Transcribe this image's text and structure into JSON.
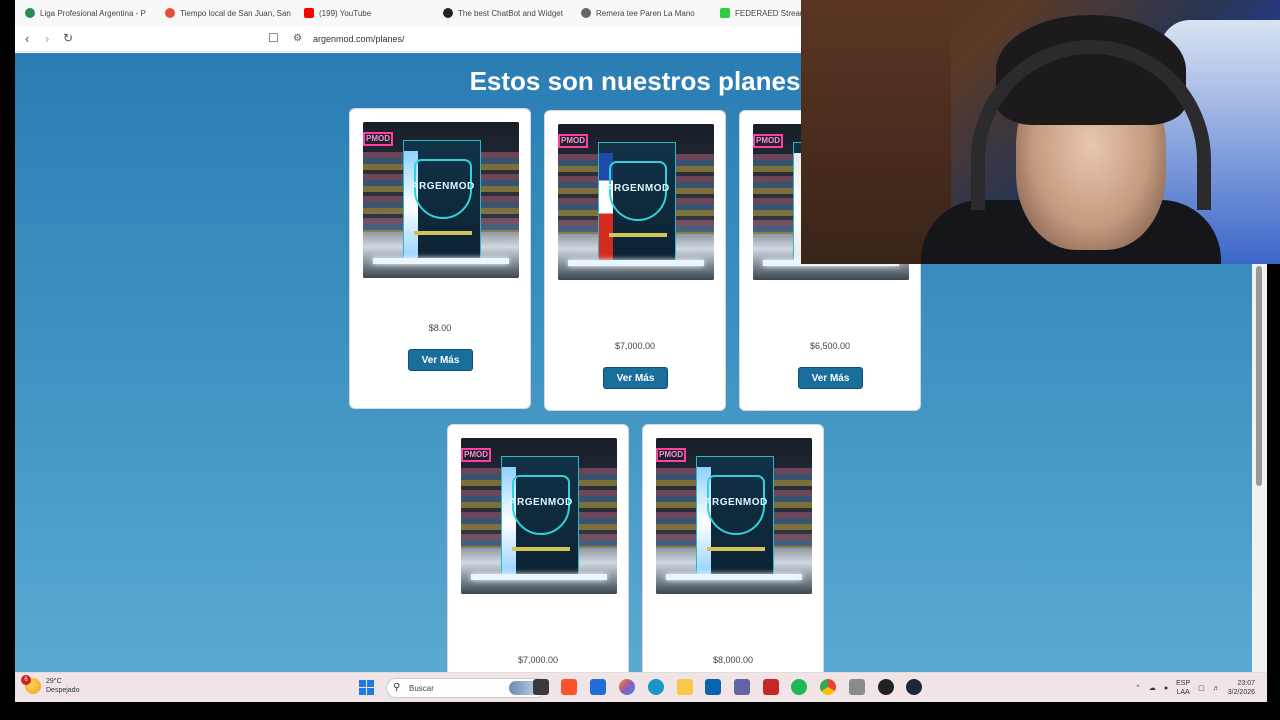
{
  "bookmarks": [
    {
      "label": "Liga Profesional Argentina - P",
      "color": "#2e8b57"
    },
    {
      "label": "Tiempo local de San Juan, San",
      "color": "#e84c3d"
    },
    {
      "label": "(199) YouTube",
      "color": "#ff0000"
    },
    {
      "label": "The best ChatBot and Widget",
      "color": "#222222"
    },
    {
      "label": "Remera tee Paren La Mano",
      "color": "#666666"
    },
    {
      "label": "FEDERAED Stream",
      "color": "#2ecc40"
    }
  ],
  "browser": {
    "url": "argenmod.com/planes/",
    "back_icon": "arrow-left-icon",
    "forward_icon": "arrow-right-icon",
    "reload_icon": "reload-icon"
  },
  "page": {
    "title": "Estos son nuestros planes",
    "image_text": {
      "neon": "PMOD",
      "box": "ARGENMOD"
    },
    "button_label": "Ver Más",
    "plans": [
      {
        "price": "$8.00",
        "flag": "argentina"
      },
      {
        "price": "$7,000.00",
        "flag": "chile"
      },
      {
        "price": "$6,500.00",
        "flag": "other"
      },
      {
        "price": "$7,000.00",
        "flag": "argentina"
      },
      {
        "price": "$8,000.00",
        "flag": "argentina"
      }
    ]
  },
  "taskbar": {
    "weather_temp": "29°C",
    "weather_desc": "Despejado",
    "weather_badge": "6",
    "search_label": "Buscar",
    "lang_line1": "ESP",
    "lang_line2": "LAA",
    "time": "23:07",
    "date": "3/2/2026",
    "apps": [
      {
        "name": "file-explorer-icon",
        "color": "#f0b400"
      },
      {
        "name": "brave-icon",
        "color": "#fb542b"
      },
      {
        "name": "store-icon",
        "color": "#1f6fd6"
      },
      {
        "name": "copilot-icon",
        "color": "#9b59b6"
      },
      {
        "name": "edge-icon",
        "color": "#1597c9"
      },
      {
        "name": "folder-icon",
        "color": "#f7c948"
      },
      {
        "name": "outlook-icon",
        "color": "#0a64ad"
      },
      {
        "name": "teams-icon",
        "color": "#6264a7"
      },
      {
        "name": "app-red-icon",
        "color": "#c62828"
      },
      {
        "name": "spotify-icon",
        "color": "#1db954"
      },
      {
        "name": "chrome-icon",
        "color": "#4285f4"
      },
      {
        "name": "tool-icon",
        "color": "#8a8a8a"
      },
      {
        "name": "app-dark-icon",
        "color": "#222222"
      },
      {
        "name": "steam-icon",
        "color": "#1b2838"
      }
    ]
  }
}
